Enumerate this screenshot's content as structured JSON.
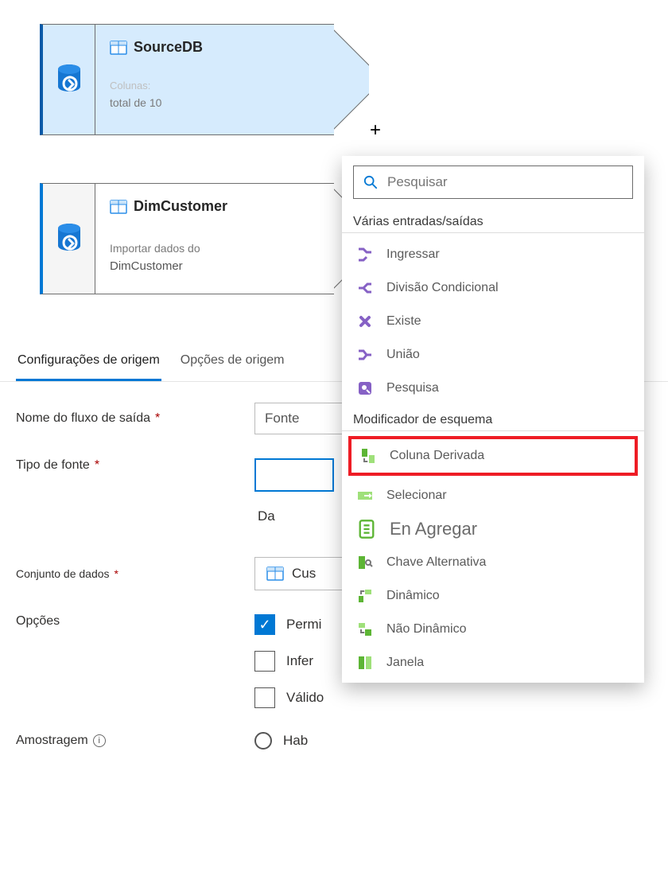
{
  "nodes": [
    {
      "title": "SourceDB",
      "columns_label": "Colunas:",
      "columns_value": "total de 10"
    },
    {
      "title": "DimCustomer",
      "desc_label": "Importar dados do",
      "desc_value": "DimCustomer"
    }
  ],
  "plus": "+",
  "tabs": {
    "t0": "Configurações de origem",
    "t1": "Opções de origem"
  },
  "form": {
    "out_name_label": "Nome do fluxo de saída",
    "out_name_value": "Fonte",
    "src_type_label": "Tipo de fonte",
    "src_type_selected": "",
    "src_type_extra": "Da",
    "dataset_label": "Conjunto de dados",
    "dataset_value": "Cus",
    "options_label": "Opções",
    "opt_permi": "Permi",
    "opt_infer": "Infer",
    "opt_valido": "Válido",
    "sampling_label": "Amostragem",
    "sampling_value": "Hab",
    "required_mark": "*"
  },
  "popover": {
    "search_placeholder": "Pesquisar",
    "groups": {
      "g1": "Várias entradas/saídas",
      "g2": "Modificador de esquema"
    },
    "items": {
      "ingressar": "Ingressar",
      "divisao": "Divisão Condicional",
      "existe": "Existe",
      "uniao": "União",
      "pesquisa": "Pesquisa",
      "coluna_derivada": "Coluna Derivada",
      "selecionar": "Selecionar",
      "agregar": "En Agregar",
      "chave": "Chave Alternativa",
      "dinamico": "Dinâmico",
      "nao_dinamico": "Não Dinâmico",
      "janela": "Janela"
    }
  }
}
